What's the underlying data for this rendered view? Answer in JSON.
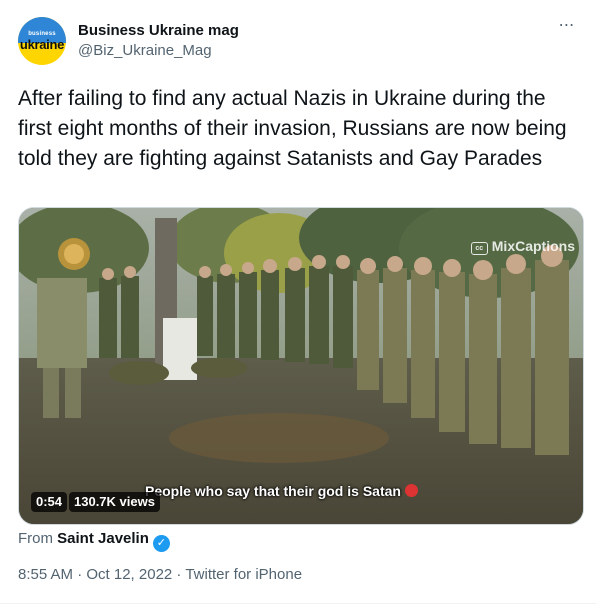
{
  "account": {
    "avatar_text_top": "business",
    "avatar_text_main": "ukraine",
    "display_name": "Business Ukraine mag",
    "handle": "@Biz_Ukraine_Mag"
  },
  "more_icon": "⋯",
  "tweet": {
    "text": "After failing to find any actual Nazis in Ukraine during the first eight months of their invasion, Russians are now being told they are fighting against Satanists and Gay Parades"
  },
  "video": {
    "watermark": "MixCaptions",
    "watermark_cc": "cc",
    "caption": "People who say that their god is Satan",
    "duration": "0:54",
    "views": "130.7K views"
  },
  "source": {
    "prefix": "From",
    "name": "Saint Javelin",
    "verified_icon": "✓"
  },
  "meta": {
    "timestamp": "8:55 AM · Oct 12, 2022 · Twitter for iPhone"
  },
  "colors": {
    "link_blue": "#1d9bf0",
    "secondary_text": "#536471",
    "primary_text": "#0f1419"
  }
}
